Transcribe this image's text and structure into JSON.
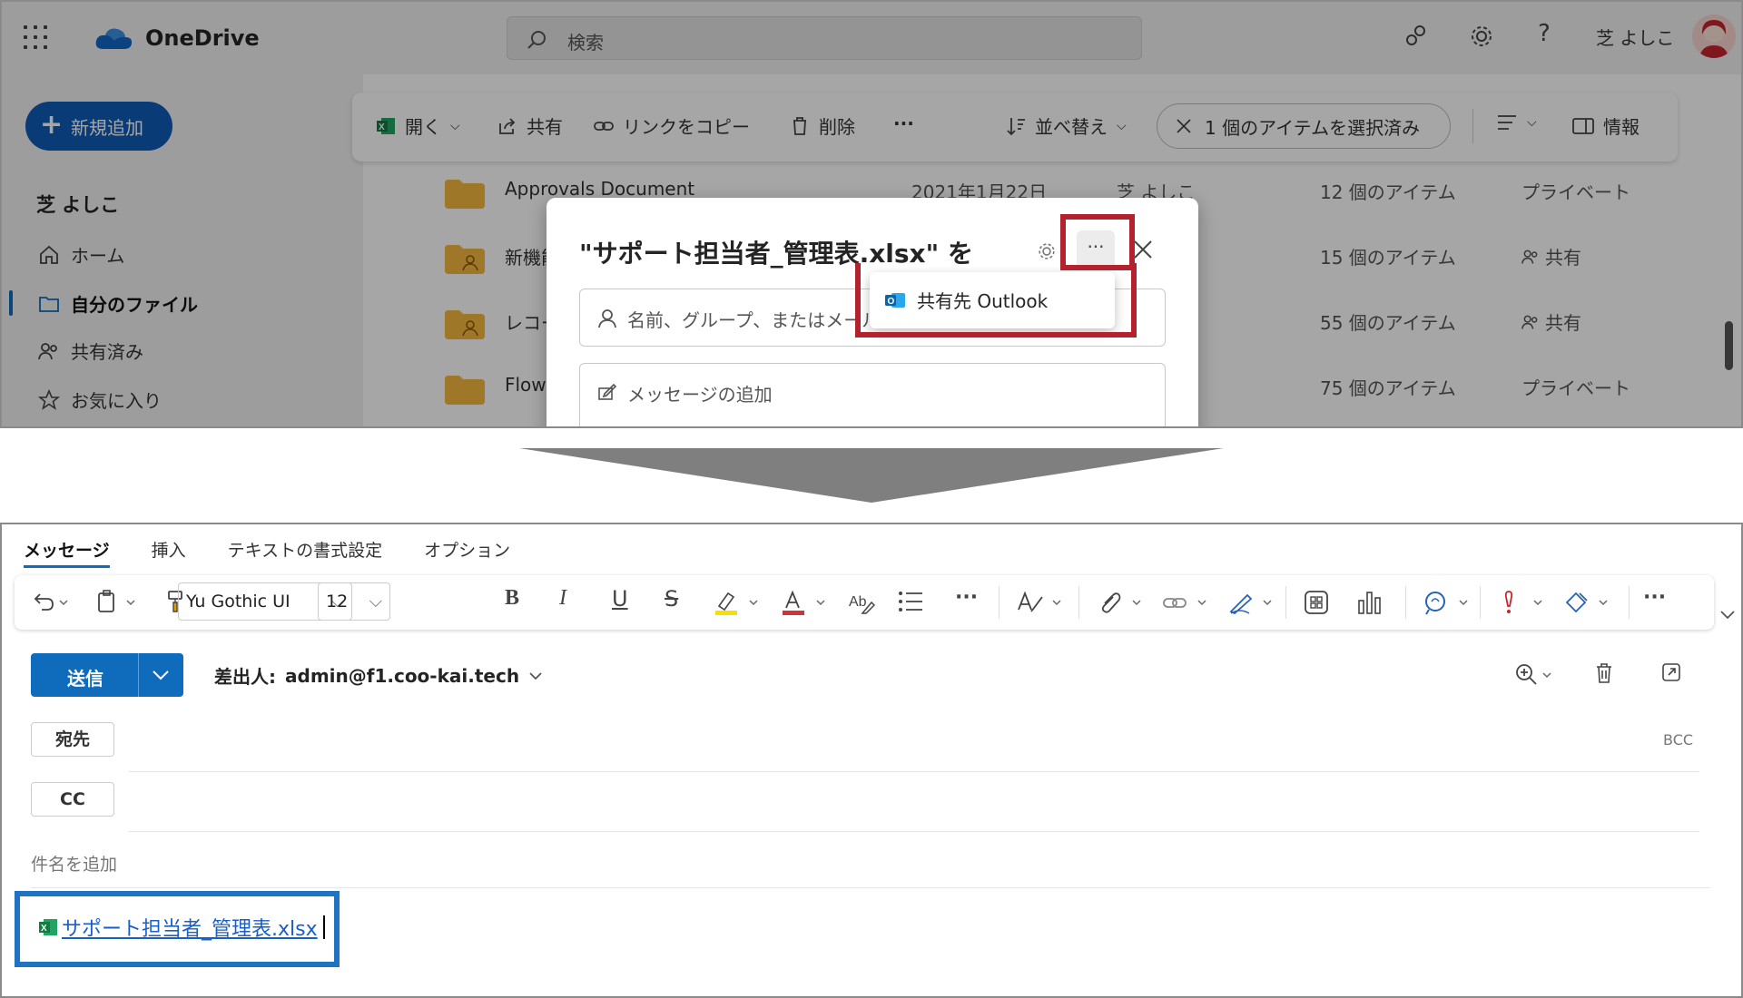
{
  "onedrive": {
    "brand": "OneDrive",
    "search_placeholder": "検索",
    "user_name": "芝 よしこ",
    "new_button": "新規追加",
    "sidebar_user": "芝 よしこ",
    "nav": [
      {
        "label": "ホーム",
        "icon": "home-icon"
      },
      {
        "label": "自分のファイル",
        "icon": "folder-icon",
        "active": true
      },
      {
        "label": "共有済み",
        "icon": "people-icon"
      },
      {
        "label": "お気に入り",
        "icon": "star-icon"
      }
    ],
    "commands": {
      "open": "開く",
      "share": "共有",
      "copy_link": "リンクをコピー",
      "delete": "削除",
      "more": "···",
      "sort": "並べ替え",
      "selected": "1 個のアイテムを選択済み",
      "info": "情報"
    },
    "files": [
      {
        "name": "Approvals Document",
        "date": "2021年1月22日",
        "owner": "芝 よしこ",
        "count": "12 個のアイテム",
        "sharing": "プライベート",
        "shared": false
      },
      {
        "name": "新機能",
        "date": "",
        "owner": "",
        "count": "15 個のアイテム",
        "sharing": "共有",
        "shared": true
      },
      {
        "name": "レコー",
        "date": "",
        "owner": "",
        "count": "55 個のアイテム",
        "sharing": "共有",
        "shared": true
      },
      {
        "name": "Flow",
        "date": "",
        "owner": "",
        "count": "75 個のアイテム",
        "sharing": "プライベート",
        "shared": false
      }
    ]
  },
  "share_dialog": {
    "title": "\"サポート担当者_管理表.xlsx\" を",
    "more": "···",
    "people_placeholder": "名前、グループ、またはメールで追加",
    "message_placeholder": "メッセージの追加",
    "menu_item": "共有先 Outlook"
  },
  "compose": {
    "tabs": [
      "メッセージ",
      "挿入",
      "テキストの書式設定",
      "オプション"
    ],
    "active_tab": "メッセージ",
    "font_name": "Yu Gothic UI",
    "font_size": "12",
    "send": "送信",
    "from_label": "差出人:",
    "from_address": "admin@f1.coo-kai.tech",
    "to": "宛先",
    "cc": "CC",
    "bcc": "BCC",
    "subject_placeholder": "件名を追加",
    "attachment": "サポート担当者_管理表.xlsx"
  },
  "colors": {
    "accent": "#0f6cbd",
    "highlight_red": "#b3232f",
    "highlight_blue": "#1f74c2",
    "excel_green": "#1d7044"
  }
}
